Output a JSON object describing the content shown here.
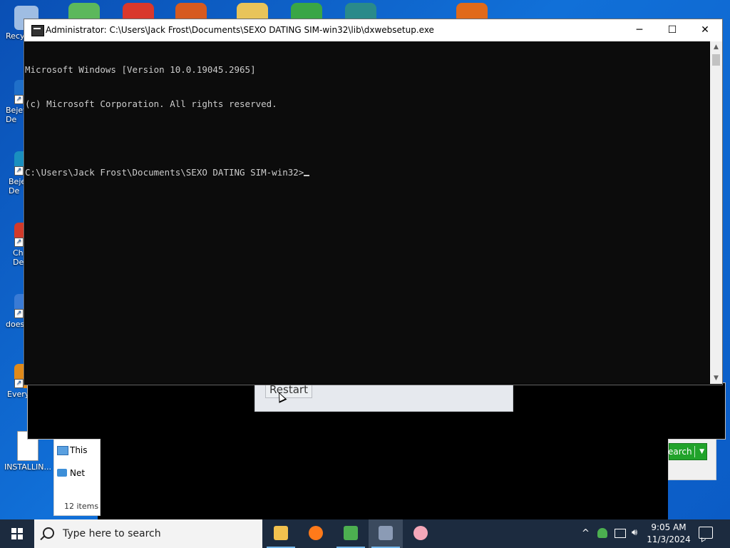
{
  "desktop": {
    "icons": [
      {
        "label": "Recy",
        "color": "#9fbde3"
      },
      {
        "label": "Bejev De",
        "color": "#1f6fc9"
      },
      {
        "label": "Beje De",
        "color": "#1a8fbf"
      },
      {
        "label": "Ch De",
        "color": "#d23a2a"
      },
      {
        "label": "does",
        "color": "#3a7bd5"
      },
      {
        "label": "Every",
        "color": "#e08a1a"
      },
      {
        "label": "INSTALLIN...",
        "color": "#ffffff"
      }
    ],
    "top_icons": [
      {
        "name": "game-icon-green",
        "color": "#5cb85c"
      },
      {
        "name": "chrome-icon",
        "color": "#d9382c"
      },
      {
        "name": "app-icon-orange",
        "color": "#d65a1f"
      },
      {
        "name": "folder-icon",
        "color": "#e8c45a"
      },
      {
        "name": "shield-icon",
        "color": "#3aa646"
      },
      {
        "name": "game-icon-teal",
        "color": "#2a8a8a"
      },
      {
        "name": "game-icon-orange",
        "color": "#e06a1a"
      }
    ]
  },
  "background_windows": {
    "explorer": {
      "item_this": "This",
      "item_net": "Net",
      "count": "12 items"
    },
    "setup": {
      "restart_label": "Restart"
    },
    "search_button": "earch"
  },
  "cmd": {
    "title": "Administrator: C:\\Users\\Jack Frost\\Documents\\SEXO DATING SIM-win32\\lib\\dxwebsetup.exe",
    "lines": [
      "Microsoft Windows [Version 10.0.19045.2965]",
      "(c) Microsoft Corporation. All rights reserved.",
      "",
      "C:\\Users\\Jack Frost\\Documents\\SEXO DATING SIM-win32>"
    ],
    "minimize": "─",
    "maximize": "☐",
    "close": "✕"
  },
  "taskbar": {
    "search_placeholder": "Type here to search",
    "apps": [
      {
        "name": "file-explorer-icon",
        "color": "#f2c14e",
        "active": false
      },
      {
        "name": "firefox-icon",
        "color": "#ff7a1a",
        "active": false
      },
      {
        "name": "game-icon-green",
        "color": "#4caf50",
        "active": false
      },
      {
        "name": "cmd-app-icon",
        "color": "#8b9bb5",
        "active": true
      },
      {
        "name": "anime-app-icon",
        "color": "#f4a7b9",
        "active": false
      }
    ],
    "tray": {
      "chevron": "^",
      "time": "9:05 AM",
      "date": "11/3/2024"
    }
  }
}
